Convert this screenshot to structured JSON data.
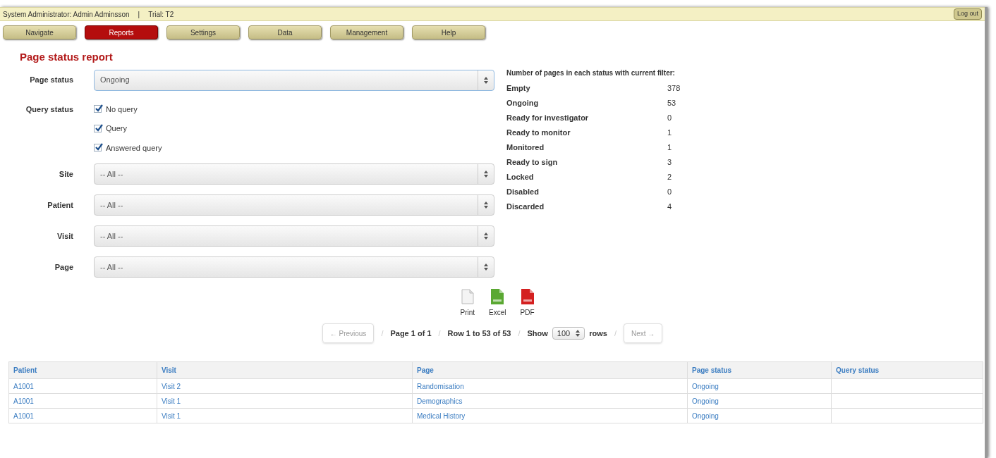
{
  "top_bar": {
    "user": "System Administrator: Admin Adminsson",
    "separator": "|",
    "trial": "Trial: T2",
    "logout": "Log out"
  },
  "nav": [
    {
      "label": "Navigate",
      "selected": false
    },
    {
      "label": "Reports",
      "selected": true
    },
    {
      "label": "Settings",
      "selected": false
    },
    {
      "label": "Data",
      "selected": false
    },
    {
      "label": "Management",
      "selected": false
    },
    {
      "label": "Help",
      "selected": false
    }
  ],
  "title": "Page status report",
  "page_status": {
    "label": "Page status",
    "value": "Ongoing"
  },
  "query_status": {
    "label": "Query status",
    "options": [
      {
        "label": "No query",
        "checked": true
      },
      {
        "label": "Query",
        "checked": true
      },
      {
        "label": "Answered query",
        "checked": true
      }
    ]
  },
  "filters": [
    {
      "label": "Site",
      "value": "-- All --"
    },
    {
      "label": "Patient",
      "value": "-- All --"
    },
    {
      "label": "Visit",
      "value": "-- All --"
    },
    {
      "label": "Page",
      "value": "-- All --"
    }
  ],
  "counts": {
    "heading": "Number of pages in each status with current filter:",
    "rows": [
      {
        "status": "Empty",
        "count": "378"
      },
      {
        "status": "Ongoing",
        "count": "53"
      },
      {
        "status": "Ready for investigator",
        "count": "0"
      },
      {
        "status": "Ready to monitor",
        "count": "1"
      },
      {
        "status": "Monitored",
        "count": "1"
      },
      {
        "status": "Ready to sign",
        "count": "3"
      },
      {
        "status": "Locked",
        "count": "2"
      },
      {
        "status": "Disabled",
        "count": "0"
      },
      {
        "status": "Discarded",
        "count": "4"
      }
    ]
  },
  "exports": [
    {
      "kind": "print",
      "label": "Print"
    },
    {
      "kind": "excel",
      "label": "Excel"
    },
    {
      "kind": "pdf",
      "label": "PDF"
    }
  ],
  "pagination": {
    "separator": "/",
    "previous": "← Previous",
    "page": "Page 1 of 1",
    "rows": "Row 1 to 53 of 53",
    "show": "Show",
    "page_size": "100",
    "rows_label": "rows",
    "next": "Next →"
  },
  "table": {
    "columns": [
      "Patient",
      "Visit",
      "Page",
      "Page status",
      "Query status"
    ],
    "rows": [
      [
        "A1001",
        "Visit 2",
        "Randomisation",
        "Ongoing",
        ""
      ],
      [
        "A1001",
        "Visit 1",
        "Demographics",
        "Ongoing",
        ""
      ],
      [
        "A1001",
        "Visit 1",
        "Medical History",
        "Ongoing",
        ""
      ]
    ]
  }
}
